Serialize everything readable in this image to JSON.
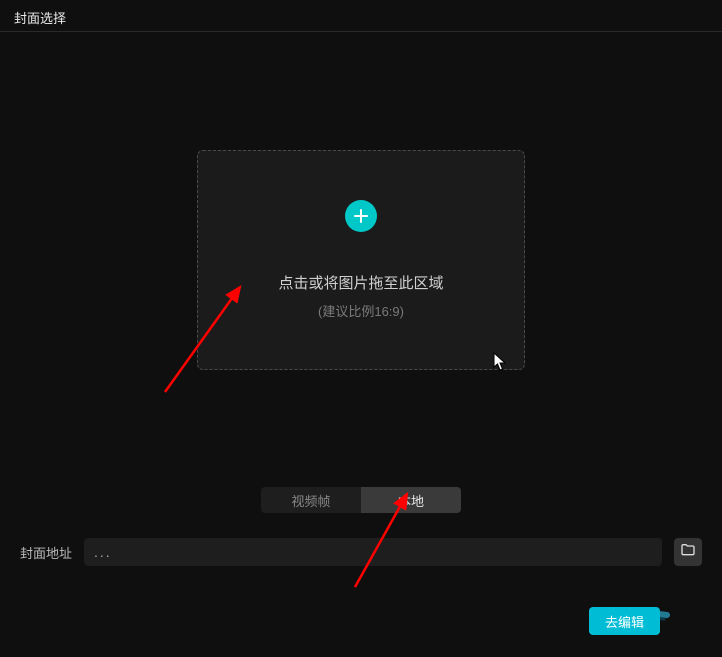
{
  "header": {
    "title": "封面选择"
  },
  "dropzone": {
    "text": "点击或将图片拖至此区域",
    "hint": "(建议比例16:9)"
  },
  "tabs": {
    "video_frame": "视频帧",
    "local": "本地"
  },
  "path": {
    "label": "封面地址",
    "value": "...",
    "placeholder": "..."
  },
  "footer": {
    "edit_button": "去编辑"
  },
  "colors": {
    "accent": "#00c8c8",
    "button": "#00bcd4",
    "arrow": "#ff0000"
  }
}
